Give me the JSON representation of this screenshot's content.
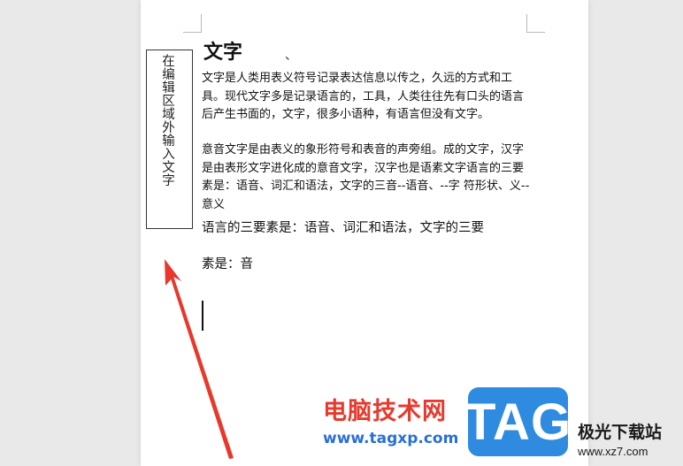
{
  "textbox": {
    "text": "在编辑区域外输入文字"
  },
  "document": {
    "title": "文字",
    "title_mark": "、",
    "paragraph1": "文字是人类用表义符号记录表达信息以传之，久远的方式和工具。现代文字多是记录语言的，工具，人类往往先有口头的语言后产生书面的，文字，很多小语种，有语言但没有文字。",
    "paragraph2": "意音文字是由表义的象形符号和表音的声旁组。成的文字，汉字是由表形文字进化成的意音文字，汉字也是语素文字语言的三要素是：语音、词汇和语法，文字的三音--语音、--字 符形状、义--意义",
    "line3": "语言的三要素是：语音、词汇和语法，文字的三要",
    "line4": "素是：音"
  },
  "watermark": {
    "title": "电脑技术网",
    "url": "www.tagxp.com",
    "badge": "TAG",
    "site_cn": "极光下载站",
    "site_url": "www.xz7.com"
  },
  "colors": {
    "arrow": "#e8382c",
    "badge": "#2f8be0",
    "watermark_title": "#e63a2e",
    "watermark_url": "#2a6fd6"
  }
}
